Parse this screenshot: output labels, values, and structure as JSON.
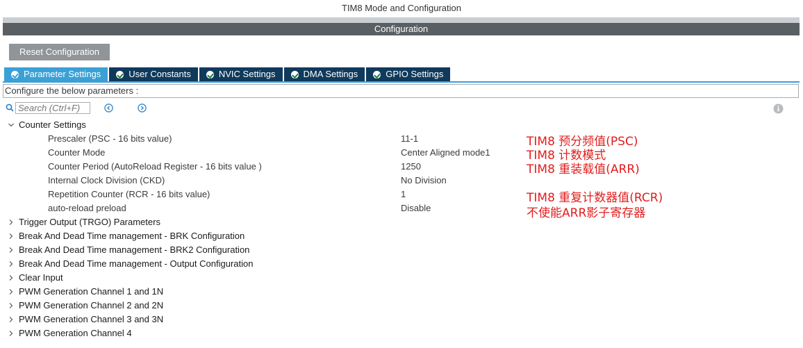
{
  "window": {
    "title": "TIM8 Mode and Configuration",
    "section": "Configuration"
  },
  "toolbar": {
    "reset_label": "Reset Configuration"
  },
  "tabs": [
    {
      "label": "Parameter Settings",
      "active": true
    },
    {
      "label": "User Constants",
      "active": false
    },
    {
      "label": "NVIC Settings",
      "active": false
    },
    {
      "label": "DMA Settings",
      "active": false
    },
    {
      "label": "GPIO Settings",
      "active": false
    }
  ],
  "description": "Configure the below parameters :",
  "search": {
    "placeholder": "Search (Ctrl+F)",
    "value": ""
  },
  "counter_settings": {
    "label": "Counter Settings",
    "expanded": true,
    "params": [
      {
        "label": "Prescaler (PSC - 16 bits value)",
        "value": "11-1"
      },
      {
        "label": "Counter Mode",
        "value": "Center Aligned mode1"
      },
      {
        "label": "Counter Period (AutoReload Register - 16 bits value )",
        "value": "1250"
      },
      {
        "label": "Internal Clock Division (CKD)",
        "value": "No Division"
      },
      {
        "label": "Repetition Counter (RCR - 16 bits value)",
        "value": "1"
      },
      {
        "label": "auto-reload preload",
        "value": "Disable"
      }
    ]
  },
  "collapsed_groups": [
    "Trigger Output (TRGO) Parameters",
    "Break And Dead Time management - BRK Configuration",
    "Break And Dead Time management - BRK2 Configuration",
    "Break And Dead Time management - Output Configuration",
    "Clear Input",
    "PWM Generation Channel 1 and 1N",
    "PWM Generation Channel 2 and 2N",
    "PWM Generation Channel 3 and 3N",
    "PWM Generation Channel 4"
  ],
  "annotations": {
    "color": "#e21d1d",
    "prescaler": "TIM8 预分频值(PSC)",
    "counter_mode": "TIM8 计数模式",
    "period": "TIM8 重装载值(ARR)",
    "repetition": "TIM8 重复计数器值(RCR)",
    "preload": "不使能ARR影子寄存器"
  },
  "colors": {
    "accent": "#3aa0d6",
    "tab_dark": "#0f3a5c",
    "header_bar": "#5a5f64",
    "button": "#8f9599"
  },
  "icons": {
    "search": "search-icon",
    "prev": "prev-circle-icon",
    "next": "next-circle-icon",
    "info": "info-icon",
    "check": "check-circle-icon",
    "expand": "chevron-down-icon",
    "collapse": "chevron-right-icon"
  }
}
